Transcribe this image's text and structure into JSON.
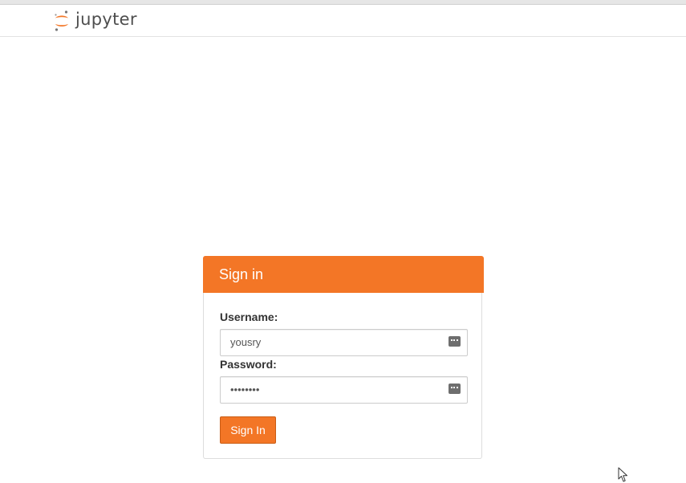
{
  "header": {
    "logo_text": "jupyter",
    "brand_color": "#f37626"
  },
  "login": {
    "title": "Sign in",
    "username_label": "Username:",
    "username_value": "yousry",
    "password_label": "Password:",
    "password_value": "••••••••",
    "submit_label": "Sign In",
    "field_icon": "password-manager-key-icon"
  },
  "cursor": {
    "icon": "mouse-pointer-icon"
  }
}
